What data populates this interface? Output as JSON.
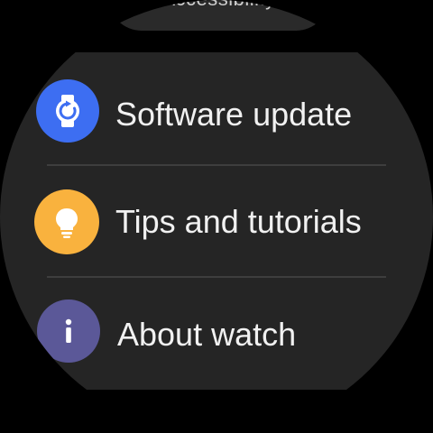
{
  "top_item": {
    "label": "Accessibility"
  },
  "menu": {
    "items": [
      {
        "label": "Software update",
        "icon": "watch-refresh-icon",
        "color": "#3d6ef2"
      },
      {
        "label": "Tips and tutorials",
        "icon": "lightbulb-icon",
        "color": "#f9b23e"
      },
      {
        "label": "About watch",
        "icon": "info-icon",
        "color": "#5b5898"
      }
    ]
  }
}
